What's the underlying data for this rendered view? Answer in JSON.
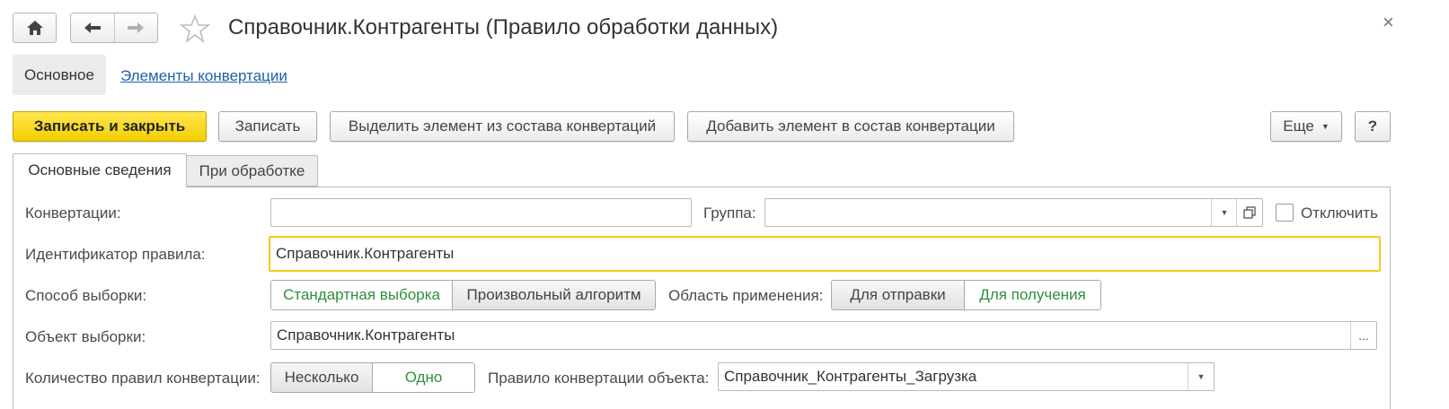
{
  "window": {
    "title": "Справочник.Контрагенты (Правило обработки данных)",
    "close_glyph": "×"
  },
  "nav_tabs": {
    "main": "Основное",
    "link": "Элементы конвертации"
  },
  "toolbar": {
    "save_close": "Записать и закрыть",
    "save": "Записать",
    "extract": "Выделить элемент из состава конвертаций",
    "add": "Добавить элемент в состав конвертации",
    "more": "Еще",
    "help": "?"
  },
  "tabs": [
    {
      "label": "Основные сведения",
      "active": true
    },
    {
      "label": "При обработке",
      "active": false
    }
  ],
  "form": {
    "conversions_label": "Конвертации:",
    "conversions_value": "",
    "group_label": "Группа:",
    "group_value": "",
    "disable_label": "Отключить",
    "rule_id_label": "Идентификатор правила:",
    "rule_id_value": "Справочник.Контрагенты",
    "sampling_label": "Способ выборки:",
    "sampling_options": [
      "Стандартная выборка",
      "Произвольный алгоритм"
    ],
    "sampling_selected": "Стандартная выборка",
    "scope_label": "Область применения:",
    "scope_options": [
      "Для отправки",
      "Для получения"
    ],
    "scope_selected": "Для получения",
    "object_label": "Объект выборки:",
    "object_value": "Справочник.Контрагенты",
    "object_button": "...",
    "count_label": "Количество правил конвертации:",
    "count_options": [
      "Несколько",
      "Одно"
    ],
    "count_selected": "Одно",
    "conv_rule_label": "Правило конвертации объекта:",
    "conv_rule_value": "Справочник_Контрагенты_Загрузка"
  },
  "colors": {
    "accent_yellow": "#f7d51f",
    "selected_green": "#2f8f3c",
    "link_blue": "#1f5faa"
  }
}
